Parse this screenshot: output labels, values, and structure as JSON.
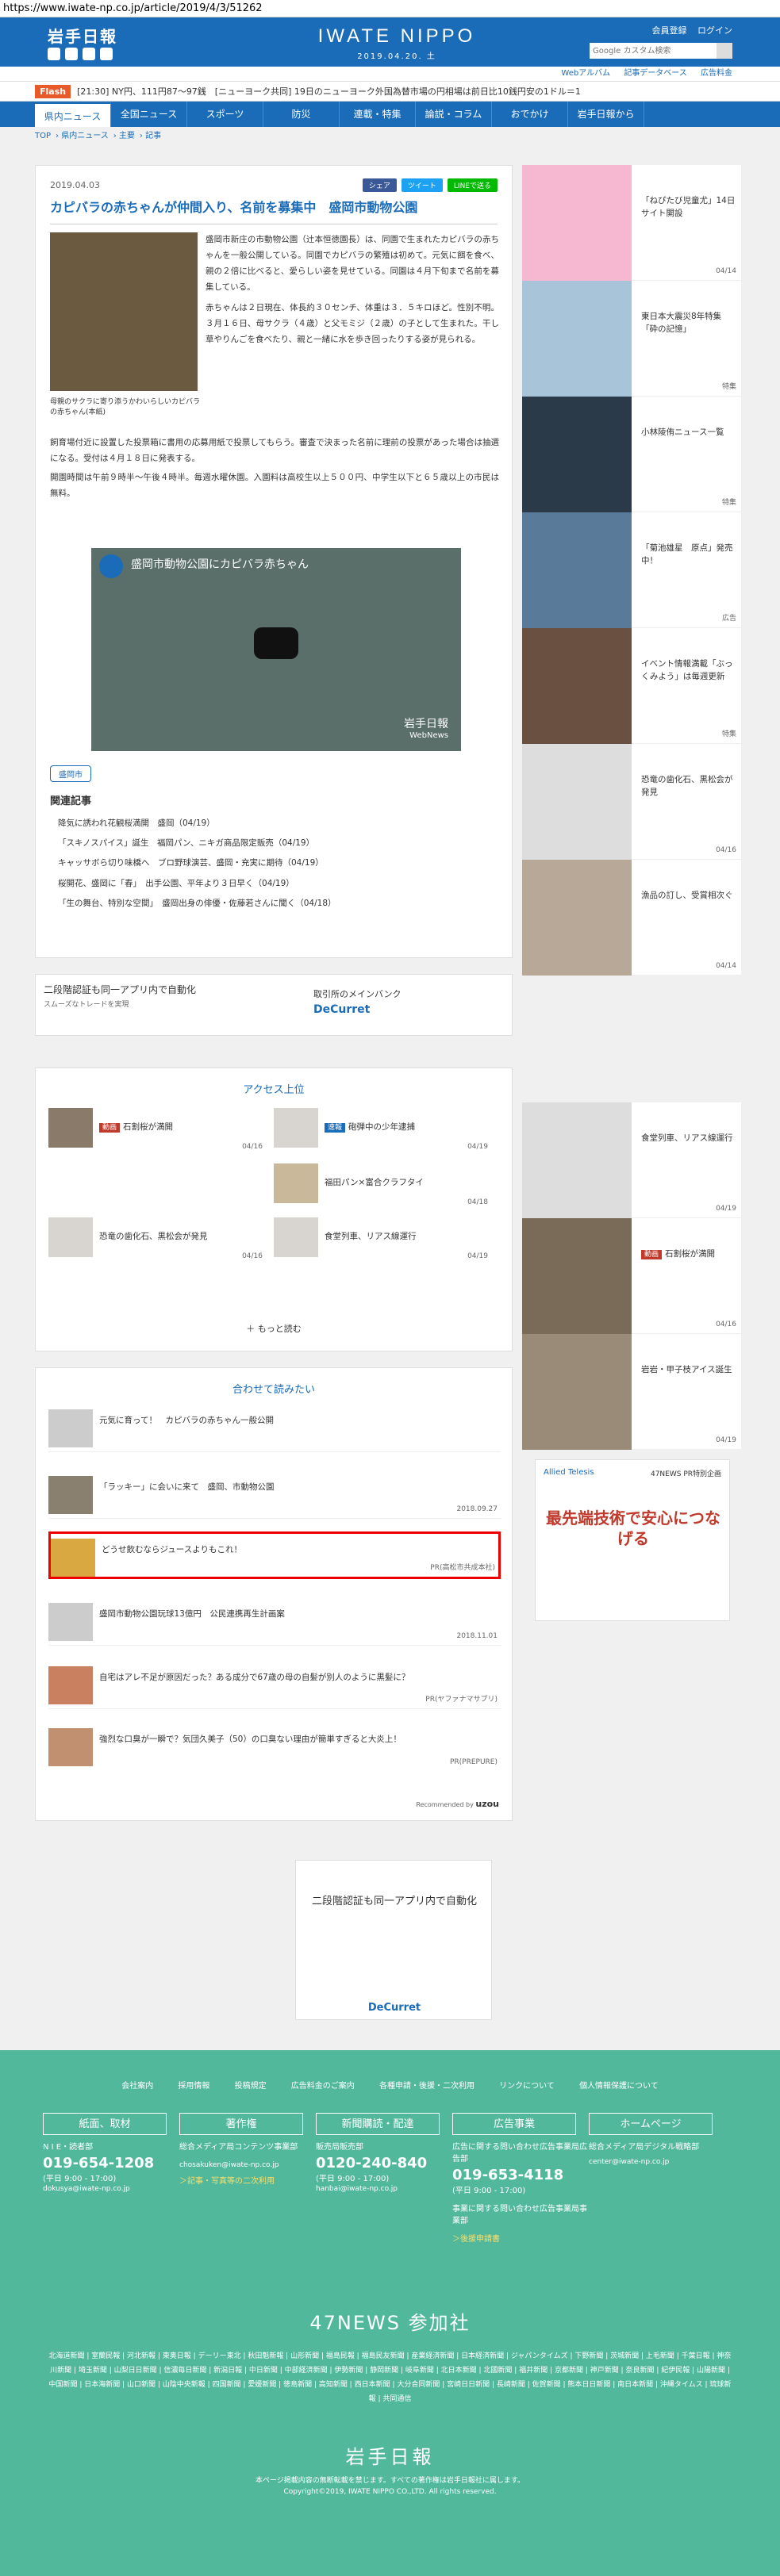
{
  "browser": {
    "url": "https://www.iwate-np.co.jp/article/2019/4/3/51262"
  },
  "header": {
    "logo_left": "岩手日報",
    "center_title": "IWATE NIPPO",
    "center_date": "2019.04.20. 土",
    "links": [
      "会員登録",
      "ログイン"
    ],
    "search_placeholder": "Google カスタム検索",
    "subnav": [
      "Webアルバム",
      "記事データベース",
      "広告料金"
    ]
  },
  "flash": {
    "label": "Flash",
    "text": "[21:30] NY円、111円87～97銭　[ニューヨーク共同] 19日のニューヨーク外国為替市場の円相場は前日比10銭円安の1ドル＝1"
  },
  "nav": [
    "県内ニュース",
    "全国ニュース",
    "スポーツ",
    "防災",
    "連載・特集",
    "論説・コラム",
    "おでかけ",
    "岩手日報から"
  ],
  "breadcrumb": [
    "TOP",
    "県内ニュース",
    "主要",
    "記事"
  ],
  "article": {
    "date": "2019.04.03",
    "share": [
      "シェア",
      "ツイート",
      "LINEで送る"
    ],
    "title": "カピバラの赤ちゃんが仲間入り、名前を募集中　盛岡市動物公園",
    "caption": "母親のサクラに寄り添うかわいらしいカピバラの赤ちゃん(本紙)",
    "p1": "盛岡市新庄の市動物公園（辻本恒徳園長）は、同園で生まれたカピバラの赤ちゃんを一般公開している。同園でカピバラの繁殖は初めて。元気に餌を食べ、親の２倍に比べると、愛らしい姿を見せている。同園は４月下旬まで名前を募集している。",
    "p2": "赤ちゃんは２日現在、体長約３０センチ、体重は３．５キロほど。性別不明。３月１６日、母サクラ（４歳）と父モミジ（２歳）の子として生まれた。干し草やりんごを食べたり、親と一緒に水を歩き回ったりする姿が見られる。",
    "p3": "飼育場付近に設置した投票箱に書用の応募用紙で投票してもらう。審査で決まった名前に理前の投票があった場合は抽選になる。受付は４月１８日に発表する。",
    "p4": "開園時間は午前９時半～午後４時半。毎週水曜休園。入園料は高校生以上５００円、中学生以下と６５歳以上の市民は無料。",
    "video_title": "盛岡市動物公園にカピバラ赤ちゃん",
    "video_brand": "岩手日報",
    "video_sub": "WebNews",
    "tag": "盛岡市",
    "related_title": "関連記事",
    "related": [
      "降気に誘われ花観桜満開　盛岡（04/19）",
      "「スキノスパイス」誕生　福岡パン、ニキガ商品限定販売（04/19）",
      "キャッサボら切り味橋へ　ブロ野球演芸、盛岡・充実に期待（04/19）",
      "桜開花、盛岡に「春」　出手公園、平年より３日早く（04/19）",
      "「生の舞台、特別な空間」　盛岡出身の俳優・佐藤若さんに聞く（04/18）"
    ]
  },
  "ad_banner": {
    "line1": "二段階認証も同一アプリ内で自動化",
    "line2": "スムーズなトレードを実現",
    "line3": "取引所のメインバンク",
    "brand": "DeCurret"
  },
  "ranking": {
    "title": "アクセス上位",
    "items": [
      {
        "badge": "動画",
        "text": "石割桜が満開",
        "date": "04/16"
      },
      {
        "badge": "速報",
        "text": "砲弾中の少年逮捕",
        "date": "04/19"
      },
      {
        "badge": "",
        "text": "福田パン×富合クラフタイ",
        "date": "04/18"
      },
      {
        "badge": "",
        "text": "恐竜の歯化石、黒松会が発見",
        "date": "04/16"
      },
      {
        "badge": "",
        "text": "食堂列車、リアス線運行",
        "date": "04/19"
      }
    ],
    "more": "もっと読む"
  },
  "reco": {
    "title": "合わせて読みたい",
    "items": [
      {
        "text": "元気に育って！　カピバラの赤ちゃん一般公開",
        "src": ""
      },
      {
        "text": "「ラッキー」に会いに来て　盛岡、市動物公園",
        "src": "2018.09.27"
      },
      {
        "text": "どうせ飲むならジュースよりもこれ！",
        "src": "PR(高松市共成本社)"
      },
      {
        "text": "盛岡市動物公園玩球13億円　公民連携再生計画案",
        "src": "2018.11.01"
      },
      {
        "text": "自宅はアレ不足が原因だった？ある成分で67歳の母の自髪が別人のように黒髪に？",
        "src": "PR(ヤファナマサプリ)"
      },
      {
        "text": "強烈な口臭が一瞬で？気団久美子（50）の口臭ない理由が簡単すぎると大炎上！",
        "src": "PR(PREPURE)"
      }
    ],
    "recommend": "Recommended by",
    "brand": "uzou"
  },
  "ad_box": {
    "line1": "二段階認証も同一アプリ内で自動化",
    "brand": "DeCurret"
  },
  "sidebar": [
    {
      "text": "「ねぴたび児童尤」14日サイト開設",
      "date": "04/14"
    },
    {
      "text": "東日本大震災8年特集「砕の記憶」",
      "date": "特集"
    },
    {
      "text": "小林陵侑ニュース一覧",
      "date": "特集"
    },
    {
      "text": "「菊池雄星　原点」発売中！",
      "date": "広告"
    },
    {
      "text": "イベント情報満載「ぶっくみよう」は毎週更新",
      "date": "特集"
    },
    {
      "text": "恐竜の歯化石、黒松会が発見",
      "date": "04/16"
    },
    {
      "text": "漁品の訂し、受賞相次ぐ",
      "date": "04/14"
    }
  ],
  "sidebar2": [
    {
      "badge": "",
      "text": "食堂列車、リアス線運行",
      "date": "04/19"
    },
    {
      "badge": "動画",
      "text": "石割桜が満開",
      "date": "04/16"
    },
    {
      "badge": "",
      "text": "岩岩・甲子枝アイス誕生",
      "date": "04/19"
    }
  ],
  "bigad": {
    "brand": "Allied Telesis",
    "tag": "47NEWS PR特別企画",
    "text": "最先端技術で安心につなげる"
  },
  "footer": {
    "nav": [
      "会社案内",
      "採用情報",
      "投稿規定",
      "広告料金のご案内",
      "各種申請・後援・二次利用",
      "リンクについて",
      "個人情報保護について"
    ],
    "cols": [
      {
        "head": "紙面、取材",
        "org": "N I E・読者部",
        "tel": "019-654-1208",
        "hours": "(平日 9:00 - 17:00)",
        "email": "dokusya@iwate-np.co.jp",
        "link": ""
      },
      {
        "head": "著作権",
        "org": "総合メディア局コンテンツ事業部",
        "tel": "",
        "hours": "",
        "email": "chosakuken@iwate-np.co.jp",
        "link": "＞記事・写真等の二次利用"
      },
      {
        "head": "新聞購読・配達",
        "org": "販売局販売部",
        "tel": "0120-240-840",
        "hours": "(平日 9:00 - 17:00)",
        "email": "hanbai@iwate-np.co.jp",
        "link": ""
      },
      {
        "head": "広告事業",
        "org": "広告に関する問い合わせ広告事業局広告部",
        "tel": "019-653-4118",
        "hours": "(平日 9:00 - 17:00)",
        "email": "事業に関する問い合わせ広告事業局事業部",
        "link": "＞後援申請書"
      },
      {
        "head": "ホームページ",
        "org": "総合メディア局デジタル戦略部",
        "tel": "",
        "hours": "",
        "email": "center@iwate-np.co.jp",
        "link": ""
      }
    ],
    "news47": "47NEWS 参加社",
    "papers": "北海道新聞 | 室蘭民報 | 河北新報 | 東奥日報 | デーリー東北 | 秋田魁新報 | 山形新聞 | 福島民報 | 福島民友新聞 | 産業経済新聞 | 日本経済新聞 | ジャパンタイムズ | 下野新聞 | 茨城新聞 | 上毛新聞 | 千葉日報 | 神奈川新聞 | 埼玉新聞 | 山梨日日新聞 | 信濃毎日新聞 | 新潟日報 | 中日新聞 | 中部経済新聞 | 伊勢新聞 | 静岡新聞 | 岐阜新聞 | 北日本新聞 | 北國新聞 | 福井新聞 | 京都新聞 | 神戸新聞 | 奈良新聞 | 紀伊民報 | 山陽新聞 | 中国新聞 | 日本海新聞 | 山口新聞 | 山陰中央新報 | 四国新聞 | 愛媛新聞 | 徳島新聞 | 高知新聞 | 西日本新聞 | 大分合同新聞 | 宮崎日日新聞 | 長崎新聞 | 佐賀新聞 | 熊本日日新聞 | 南日本新聞 | 沖縄タイムス | 琉球新報 | 共同通信",
    "logo": "岩手日報",
    "copy1": "本ページ掲載内容の無断転載を禁じます。すべての著作権は岩手日報社に属します。",
    "copy2": "Copyright©2019, IWATE NIPPO CO.,LTD. All rights reserved."
  }
}
